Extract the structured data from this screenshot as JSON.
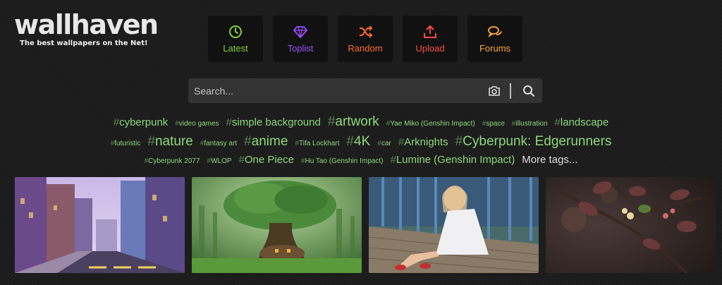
{
  "logo": {
    "text": "wallhaven",
    "tagline": "The best wallpapers on the Net!"
  },
  "nav": [
    {
      "label": "Latest",
      "icon": "clock-icon",
      "color": "#85cc40"
    },
    {
      "label": "Toplist",
      "icon": "diamond-icon",
      "color": "#9b4fff"
    },
    {
      "label": "Random",
      "icon": "shuffle-icon",
      "color": "#ff6a2e"
    },
    {
      "label": "Upload",
      "icon": "upload-icon",
      "color": "#ff4a4a"
    },
    {
      "label": "Forums",
      "icon": "comments-icon",
      "color": "#ffa83f"
    }
  ],
  "search": {
    "placeholder": "Search...",
    "camera_icon": "camera-icon",
    "search_icon": "search-icon"
  },
  "tags": {
    "row1": [
      "cyberpunk",
      "video games",
      "simple background",
      "artwork",
      "Yae Miko (Genshin Impact)",
      "space",
      "illustration",
      "landscape"
    ],
    "row2": [
      "futuristic",
      "nature",
      "fantasy art",
      "anime",
      "Tifa Lockhart",
      "4K",
      "car",
      "Arknights",
      "Cyberpunk: Edgerunners"
    ],
    "row3": [
      "Cyberpunk 2077",
      "WLOP",
      "One Piece",
      "Hu Tao (Genshin Impact)",
      "Lumine (Genshin Impact)"
    ],
    "more": "More tags..."
  },
  "colors": {
    "accent": "#8ed77b",
    "background": "#1b1b1b",
    "button_bg": "#111111"
  }
}
